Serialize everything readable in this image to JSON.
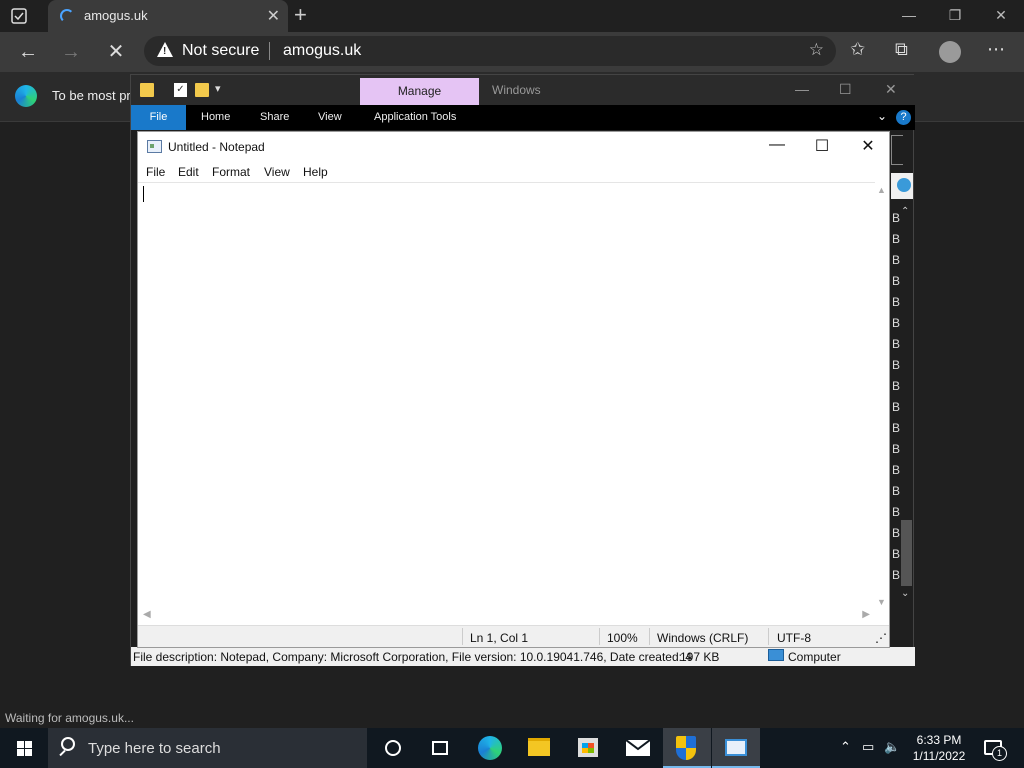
{
  "browser": {
    "tab_title": "amogus.uk",
    "security_label": "Not secure",
    "url": "amogus.uk",
    "infobar_text": "To be most pr",
    "status_text": "Waiting for amogus.uk..."
  },
  "explorer": {
    "manage_tab": "Manage",
    "windows_label": "Windows",
    "ribbon": {
      "file": "File",
      "home": "Home",
      "share": "Share",
      "view": "View",
      "app_tools": "Application Tools"
    },
    "side_letters": [
      "B",
      "B",
      "B",
      "B",
      "B",
      "B",
      "B",
      "B",
      "B",
      "B",
      "B",
      "B",
      "B",
      "B",
      "B",
      "B",
      "B",
      "B"
    ],
    "status_description": "File description: Notepad, Company: Microsoft Corporation, File version: 10.0.19041.746, Date created: 4",
    "status_size": "197 KB",
    "status_location": "Computer"
  },
  "notepad": {
    "title": "Untitled - Notepad",
    "menu": {
      "file": "File",
      "edit": "Edit",
      "format": "Format",
      "view": "View",
      "help": "Help"
    },
    "content": "",
    "status": {
      "position": "Ln 1, Col 1",
      "zoom": "100%",
      "line_ending": "Windows (CRLF)",
      "encoding": "UTF-8"
    }
  },
  "taskbar": {
    "search_placeholder": "Type here to search",
    "time": "6:33 PM",
    "date": "1/11/2022",
    "notification_count": "1"
  },
  "colors": {
    "accent": "#1979ca",
    "manage_tab": "#e5c4f4",
    "taskbar": "#101820"
  }
}
